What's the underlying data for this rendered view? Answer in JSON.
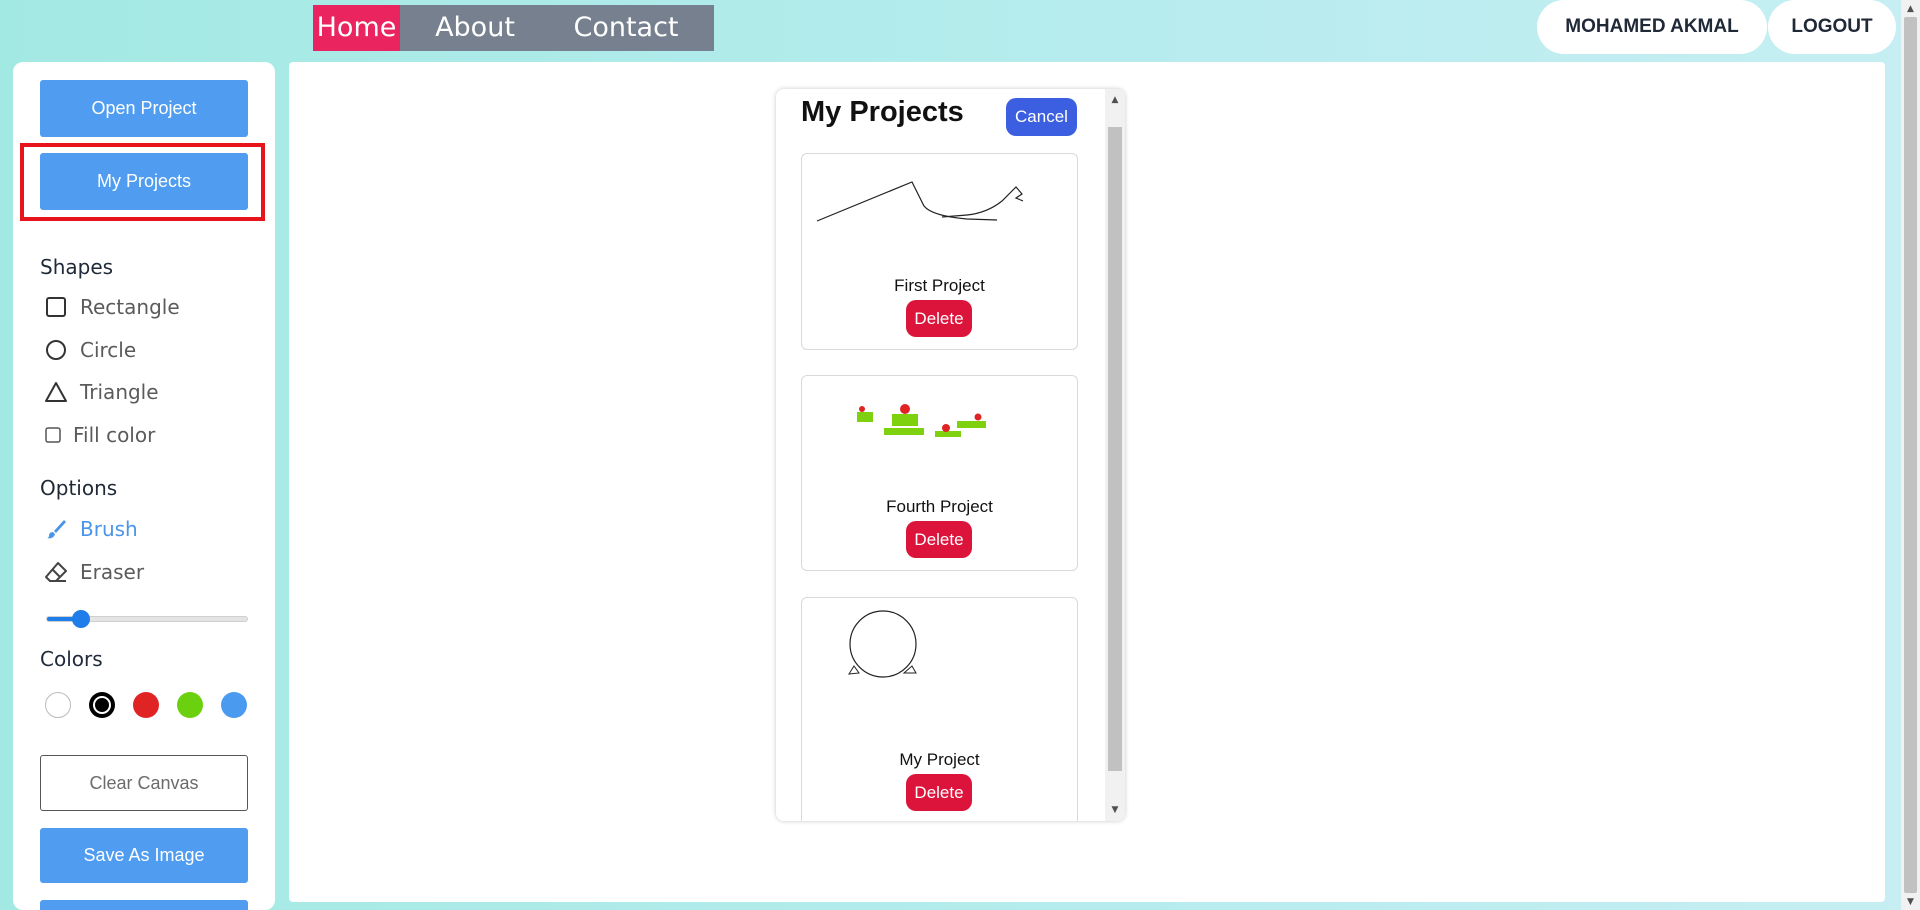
{
  "nav": {
    "home": "Home",
    "about": "About",
    "contact": "Contact"
  },
  "user": {
    "name": "MOHAMED AKMAL",
    "logout": "LOGOUT"
  },
  "sidebar": {
    "open_project": "Open Project",
    "my_projects": "My Projects",
    "shapes_title": "Shapes",
    "shapes": [
      {
        "label": "Rectangle",
        "icon": "square-icon"
      },
      {
        "label": "Circle",
        "icon": "circle-icon"
      },
      {
        "label": "Triangle",
        "icon": "triangle-icon"
      }
    ],
    "fill_color": "Fill color",
    "options_title": "Options",
    "options": [
      {
        "label": "Brush",
        "icon": "brush-icon",
        "active": true
      },
      {
        "label": "Eraser",
        "icon": "eraser-icon",
        "active": false
      }
    ],
    "brush_size_fraction": 0.17,
    "colors_title": "Colors",
    "colors": [
      "#ffffff",
      "#000000",
      "#e02424",
      "#6bd10f",
      "#4a9af0"
    ],
    "selected_color": "#000000",
    "clear_canvas": "Clear Canvas",
    "save_as_image": "Save As Image"
  },
  "modal": {
    "title": "My Projects",
    "cancel": "Cancel",
    "projects": [
      {
        "name": "First Project",
        "delete": "Delete"
      },
      {
        "name": "Fourth Project",
        "delete": "Delete"
      },
      {
        "name": "My Project",
        "delete": "Delete"
      }
    ]
  },
  "theme": {
    "accent_blue": "#4f9cf0",
    "home_pink": "#e9245f",
    "delete_red": "#dc143c",
    "cancel_blue": "#3b5fe0",
    "highlight_red": "#e8141c"
  }
}
